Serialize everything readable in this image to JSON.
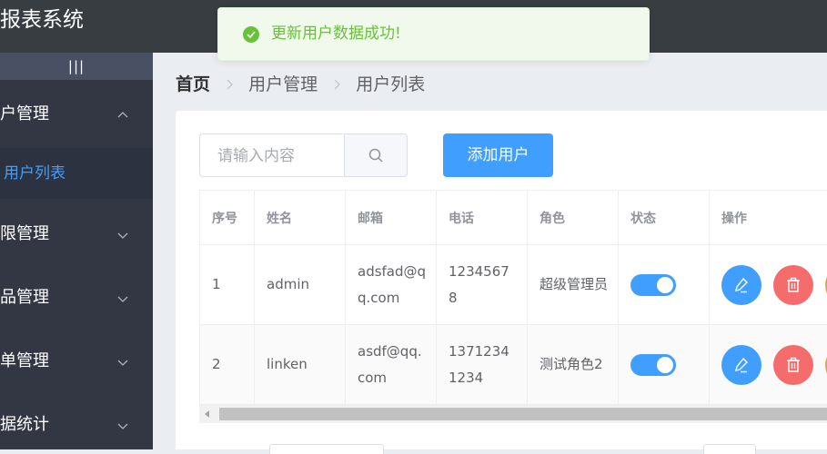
{
  "app": {
    "title": "报表系统"
  },
  "sidebar": {
    "toggle_label": "|||",
    "menus": [
      {
        "label": "户管理",
        "expanded": true
      },
      {
        "label": "限管理"
      },
      {
        "label": "品管理"
      },
      {
        "label": "单管理"
      },
      {
        "label": "据统计"
      }
    ],
    "active_submenu": "用户列表"
  },
  "breadcrumb": [
    "首页",
    "用户管理",
    "用户列表"
  ],
  "toolbar": {
    "search_placeholder": "请输入内容",
    "add_label": "添加用户"
  },
  "table": {
    "headers": [
      "序号",
      "姓名",
      "邮箱",
      "电话",
      "角色",
      "状态",
      "操作"
    ],
    "rows": [
      {
        "index": "1",
        "name": "admin",
        "email": "adsfad@qq.com",
        "phone": "12345678",
        "role": "超级管理员",
        "status": true
      },
      {
        "index": "2",
        "name": "linken",
        "email": "asdf@qq.com",
        "phone": "13712341234",
        "role": "测试角色2",
        "status": true
      }
    ]
  },
  "toast": {
    "message": "更新用户数据成功!",
    "type": "success"
  },
  "colors": {
    "primary": "#409eff",
    "danger": "#f56c6c",
    "success": "#67c23a",
    "warning": "#e6a23c",
    "sidebar": "#333744",
    "header": "#373d41"
  },
  "icons": {
    "search": "search-icon",
    "edit": "edit-icon",
    "delete": "trash-icon",
    "success": "check-circle-icon",
    "chevron": "chevron-icon"
  }
}
